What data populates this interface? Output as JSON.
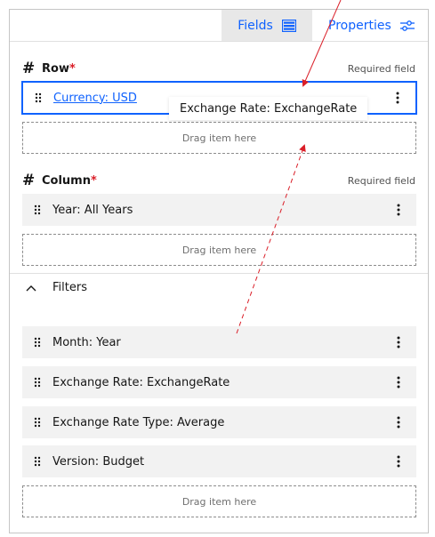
{
  "tabs": {
    "fields_label": "Fields",
    "properties_label": "Properties"
  },
  "row_section": {
    "title": "Row",
    "required_mark": "*",
    "required_label": "Required field",
    "items": [
      {
        "label": "Currency: USD"
      }
    ],
    "dropzone_label": "Drag item here"
  },
  "column_section": {
    "title": "Column",
    "required_mark": "*",
    "required_label": "Required field",
    "items": [
      {
        "label": "Year: All Years"
      }
    ],
    "dropzone_label": "Drag item here"
  },
  "filters_section": {
    "title": "Filters",
    "items": [
      {
        "label": "Month: Year"
      },
      {
        "label": "Exchange Rate: ExchangeRate"
      },
      {
        "label": "Exchange Rate Type: Average"
      },
      {
        "label": "Version: Budget"
      }
    ],
    "dropzone_label": "Drag item here"
  },
  "drag_ghost": {
    "label": "Exchange Rate: ExchangeRate"
  },
  "colors": {
    "accent": "#0f62fe",
    "required": "#da1e28",
    "annotation_arrow": "#da1e28",
    "item_bg": "#f2f2f2"
  }
}
